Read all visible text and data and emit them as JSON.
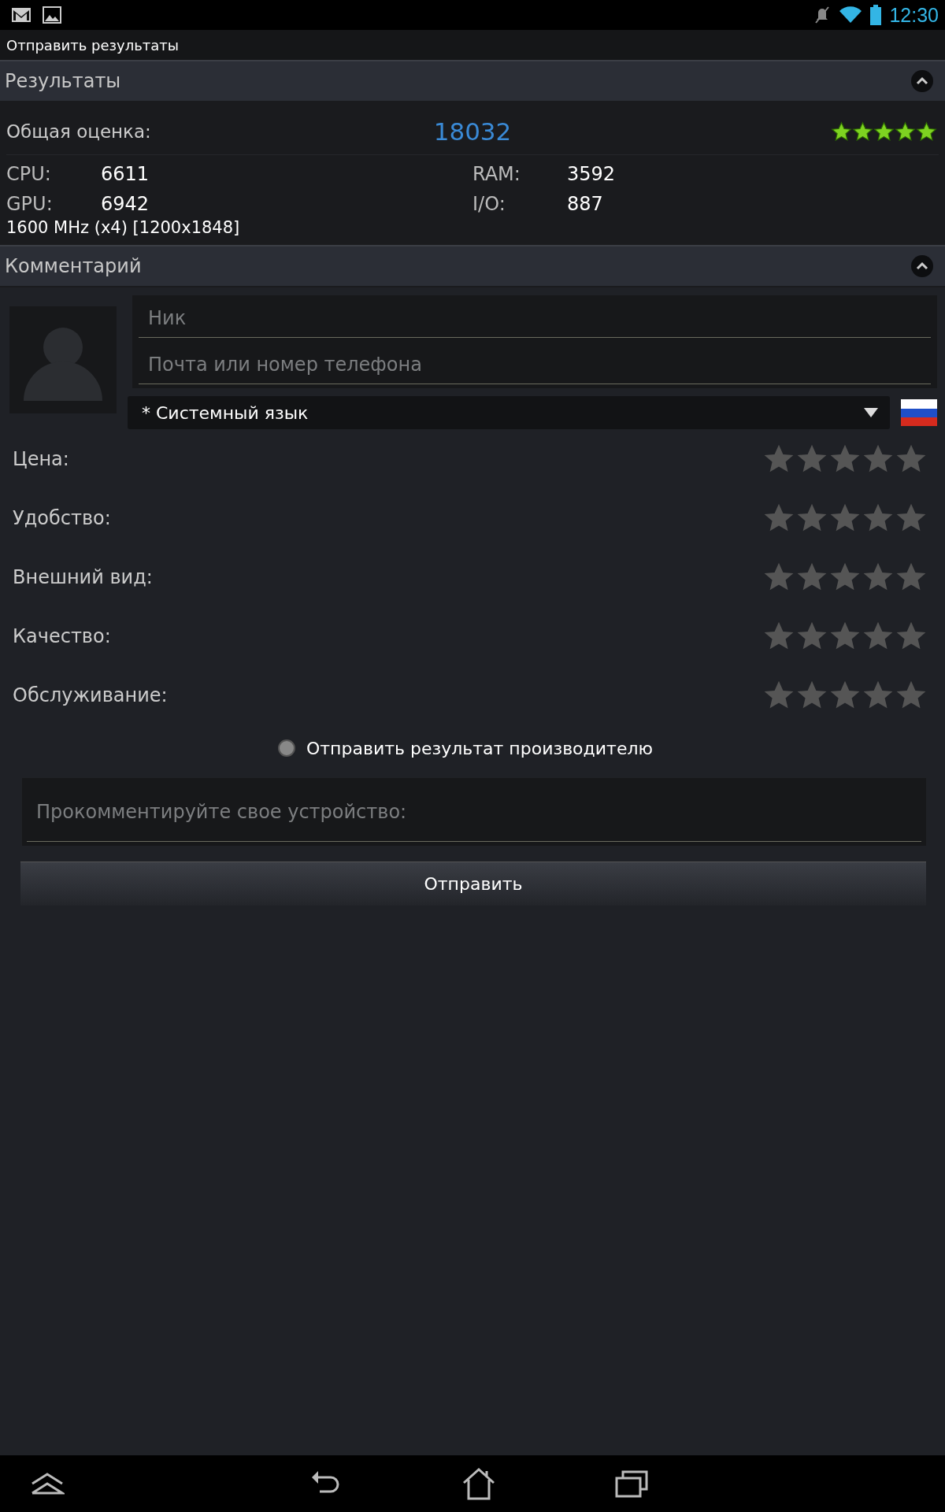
{
  "status_bar": {
    "time": "12:30"
  },
  "action_bar": {
    "title": "Отправить результаты"
  },
  "results": {
    "title": "Результаты",
    "expanded": true,
    "overall_label": "Общая оценка:",
    "overall_score": "18032",
    "stars": 5,
    "metrics": [
      {
        "label": "CPU:",
        "value": "6611"
      },
      {
        "label": "RAM:",
        "value": "3592"
      },
      {
        "label": "GPU:",
        "value": "6942"
      },
      {
        "label": "I/O:",
        "value": "887"
      }
    ],
    "device_info": "1600 MHz (x4) [1200x1848]"
  },
  "comment": {
    "title": "Комментарий",
    "expanded": true,
    "nick": {
      "placeholder": "Ник"
    },
    "contact": {
      "placeholder": "Почта или номер телефона"
    },
    "language": {
      "value": "* Системный язык"
    },
    "ratings": [
      {
        "label": "Цена:",
        "stars": 0
      },
      {
        "label": "Удобство:",
        "stars": 0
      },
      {
        "label": "Внешний вид:",
        "stars": 0
      },
      {
        "label": "Качество:",
        "stars": 0
      },
      {
        "label": "Обслуживание:",
        "stars": 0
      }
    ],
    "send_to_vendor": {
      "label": "Отправить результат производителю",
      "checked": false
    },
    "comment_field": {
      "placeholder": "Прокомментируйте свое устройство:"
    },
    "submit": "Отправить"
  }
}
